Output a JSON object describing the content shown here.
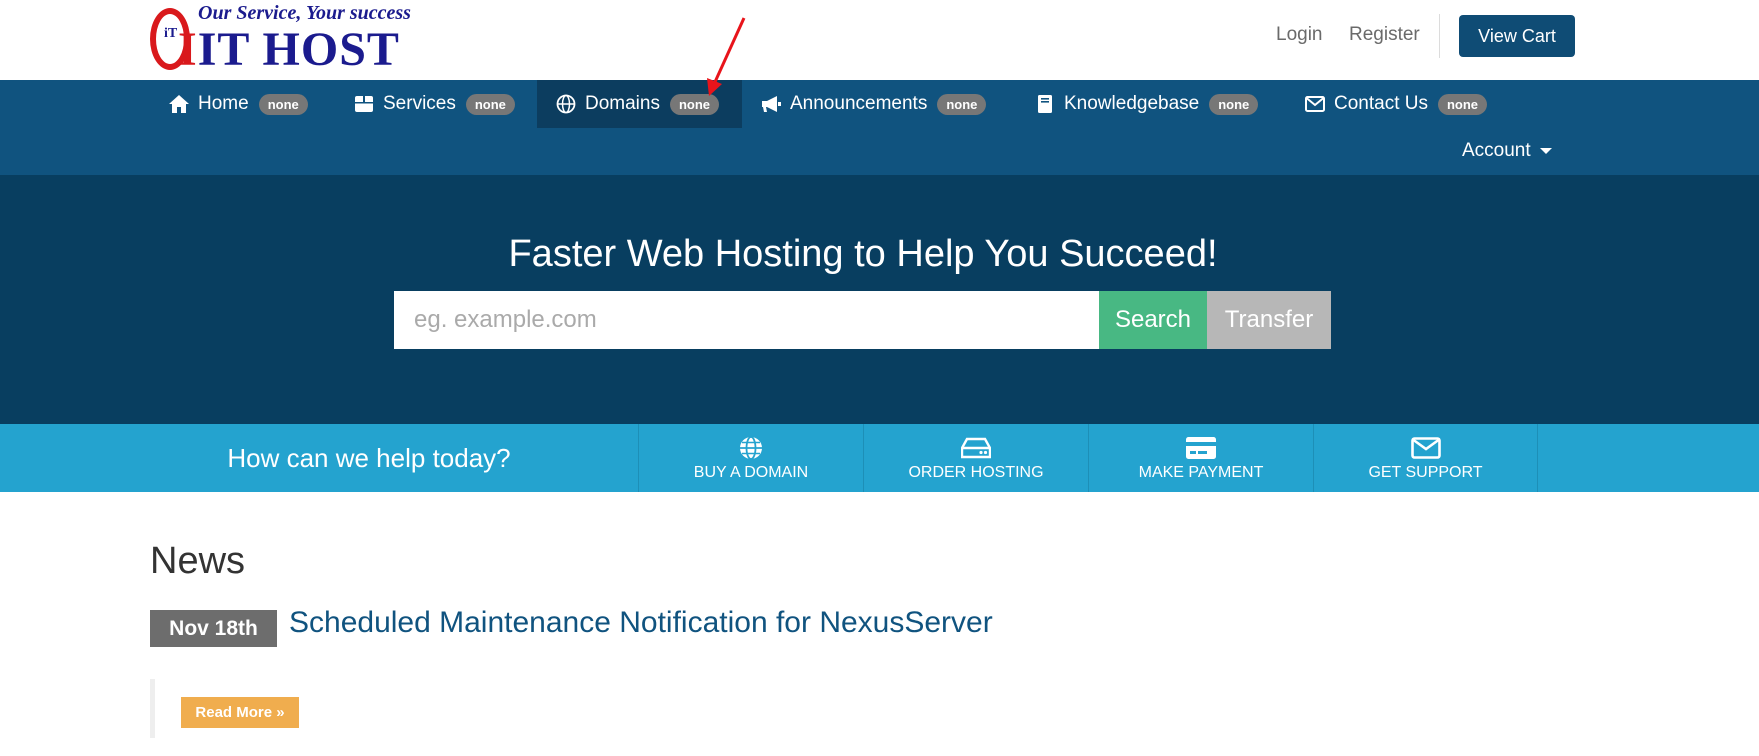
{
  "header": {
    "logo_tagline": "Our Service, Your success",
    "logo_brand": "IT HOST",
    "logo_mark": "iT",
    "login": "Login",
    "register": "Register",
    "view_cart": "View Cart"
  },
  "nav": {
    "items": [
      {
        "label": "Home",
        "badge": "none",
        "icon": "home-icon"
      },
      {
        "label": "Services",
        "badge": "none",
        "icon": "box-icon"
      },
      {
        "label": "Domains",
        "badge": "none",
        "icon": "globe-icon"
      },
      {
        "label": "Announcements",
        "badge": "none",
        "icon": "megaphone-icon"
      },
      {
        "label": "Knowledgebase",
        "badge": "none",
        "icon": "book-icon"
      },
      {
        "label": "Contact Us",
        "badge": "none",
        "icon": "envelope-icon"
      }
    ],
    "account": "Account"
  },
  "hero": {
    "headline": "Faster Web Hosting to Help You Succeed!",
    "placeholder": "eg. example.com",
    "search": "Search",
    "transfer": "Transfer"
  },
  "help": {
    "text": "How can we help today?",
    "actions": [
      {
        "label": "BUY A DOMAIN",
        "icon": "globe-icon"
      },
      {
        "label": "ORDER HOSTING",
        "icon": "server-icon"
      },
      {
        "label": "MAKE PAYMENT",
        "icon": "credit-card-icon"
      },
      {
        "label": "GET SUPPORT",
        "icon": "envelope-icon"
      }
    ]
  },
  "news": {
    "title": "News",
    "items": [
      {
        "date": "Nov 18th",
        "title": "Scheduled Maintenance Notification for NexusServer",
        "read_more": "Read More »"
      }
    ]
  },
  "colors": {
    "nav": "#10537f",
    "hero": "#083e60",
    "helpbar": "#24a3cf",
    "search": "#48b883",
    "read_more": "#f0ad4e",
    "annotation_arrow": "#e8141b"
  }
}
